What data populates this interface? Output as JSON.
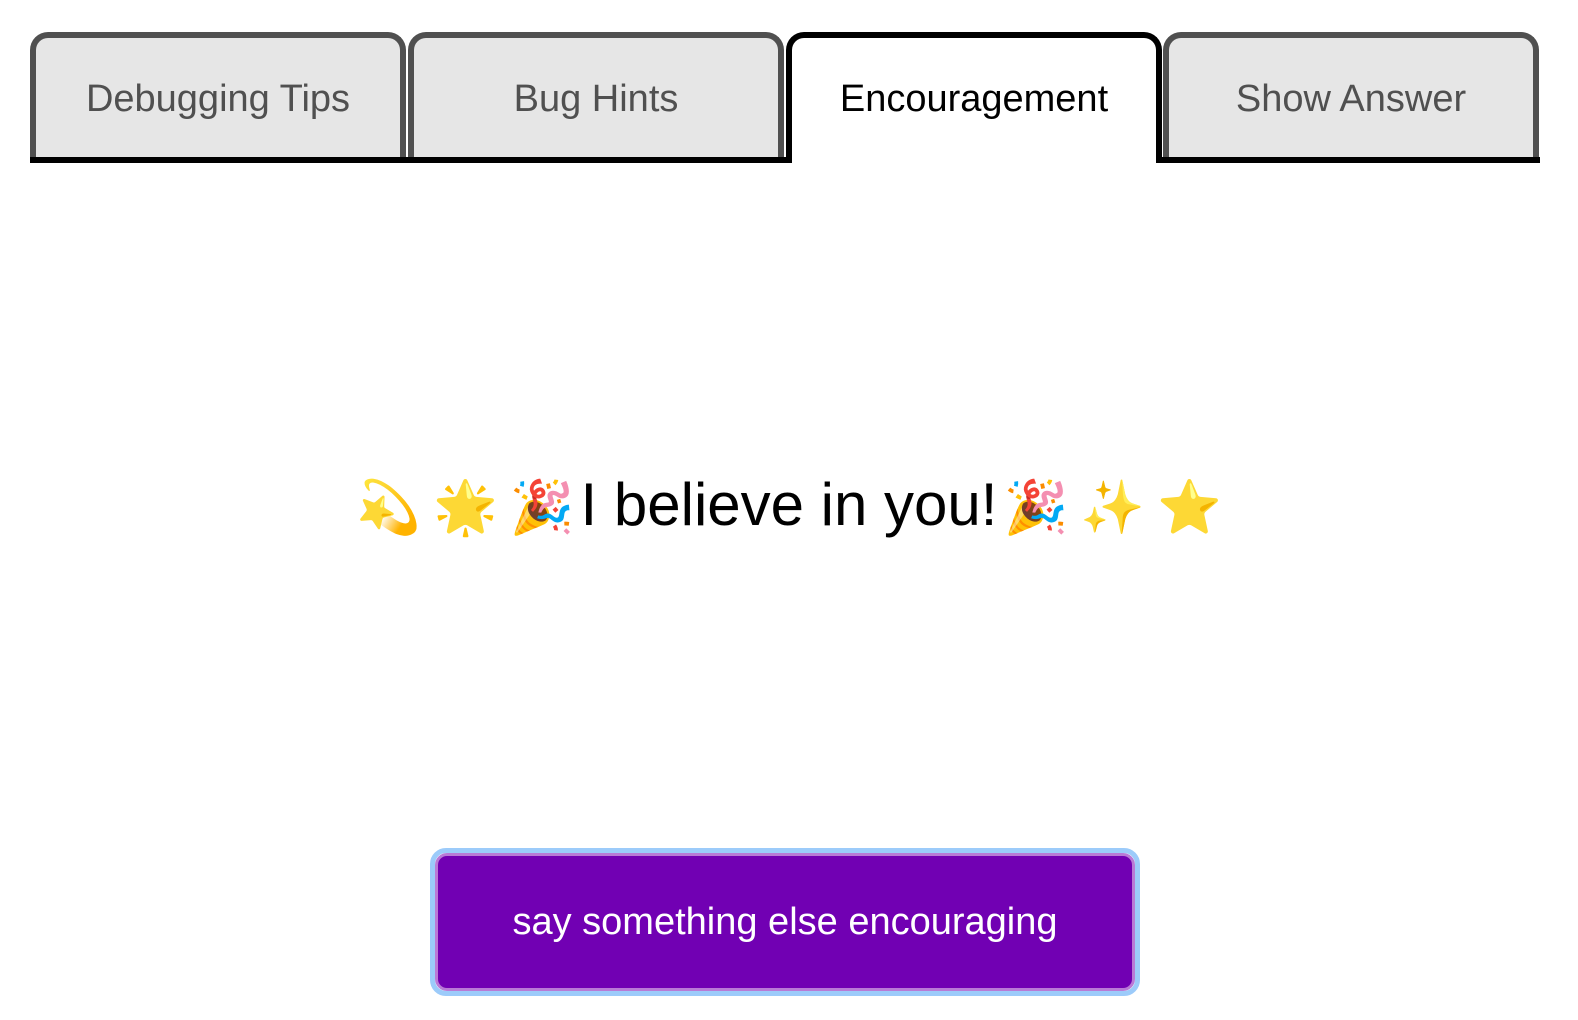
{
  "tabs": [
    {
      "label": "Debugging Tips",
      "active": false
    },
    {
      "label": "Bug Hints",
      "active": false
    },
    {
      "label": "Encouragement",
      "active": true
    },
    {
      "label": "Show Answer",
      "active": false
    }
  ],
  "message": {
    "leading_emojis": [
      "💫",
      "🌟",
      "🎉"
    ],
    "text": "I believe in you!",
    "trailing_emojis": [
      "🎉",
      "✨",
      "⭐"
    ]
  },
  "button": {
    "label": "say something else encouraging",
    "color": "#7100b3",
    "focus_ring_color": "#9ccbfa"
  }
}
